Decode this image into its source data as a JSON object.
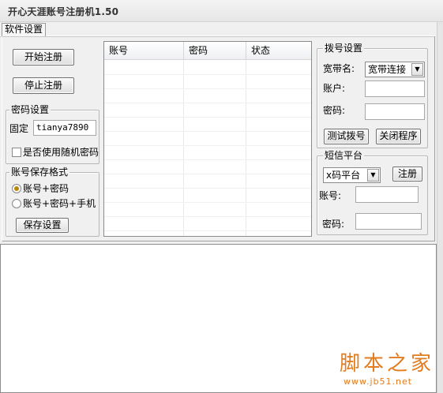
{
  "window": {
    "title": "开心天涯账号注册机1.50"
  },
  "tabs": [
    {
      "label": "软件设置"
    }
  ],
  "actions": {
    "start_label": "开始注册",
    "stop_label": "停止注册"
  },
  "password_settings": {
    "legend": "密码设置",
    "fixed_label": "固定",
    "fixed_value": "tianya7890",
    "random_label": "是否使用随机密码",
    "random_checked": false
  },
  "save_format": {
    "legend": "账号保存格式",
    "options": [
      {
        "label": "账号+密码",
        "selected": true
      },
      {
        "label": "账号+密码+手机",
        "selected": false
      }
    ],
    "save_label": "保存设置"
  },
  "table": {
    "columns": [
      "账号",
      "密码",
      "状态"
    ],
    "rows": []
  },
  "dialup": {
    "legend": "拨号设置",
    "broadband_label": "宽带名:",
    "broadband_value": "宽带连接",
    "account_label": "账户:",
    "account_value": "",
    "password_label": "密码:",
    "password_value": "",
    "test_label": "测试拨号",
    "close_label": "关闭程序"
  },
  "sms": {
    "legend": "短信平台",
    "platform_value": "x码平台",
    "register_label": "注册",
    "account_label": "账号:",
    "account_value": "",
    "password_label": "密码:",
    "password_value": ""
  },
  "log": {
    "text": ""
  },
  "watermark": {
    "brand": "脚本之家",
    "url": "www.jb51.net"
  },
  "colors": {
    "radio_selected": "#b8860b",
    "watermark": "#e27c1f"
  }
}
